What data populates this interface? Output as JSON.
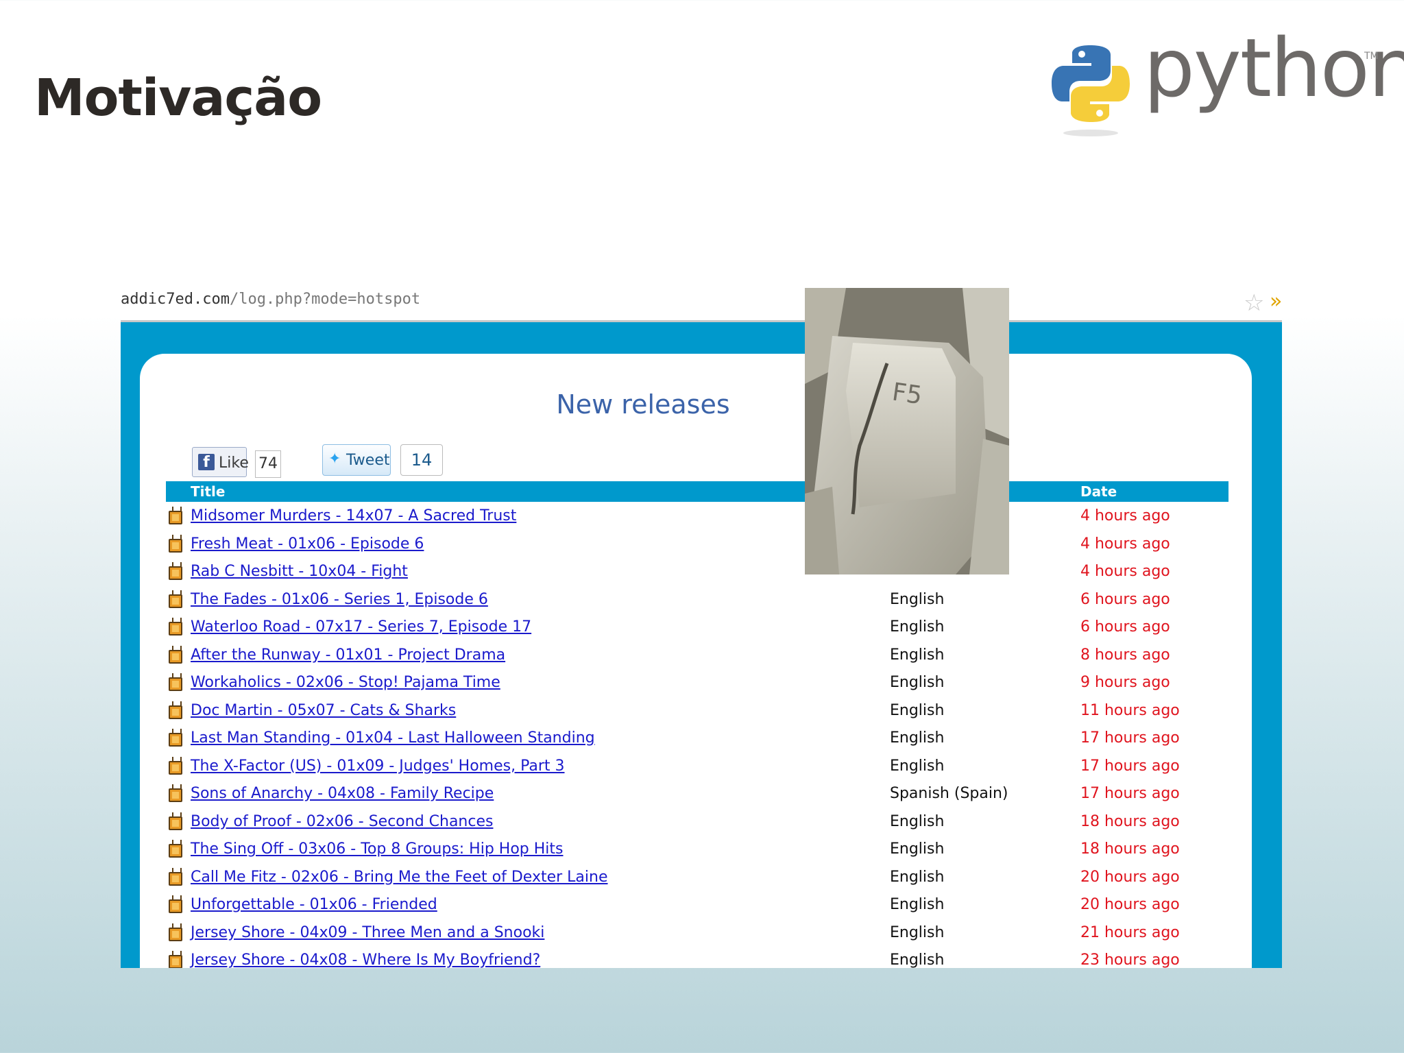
{
  "slide": {
    "title": "Motivação"
  },
  "logo": {
    "text": "python",
    "tm": "TM"
  },
  "browser": {
    "url_host": "addic7ed.com",
    "url_path": "/log.php?mode=hotspot"
  },
  "page": {
    "heading": "New releases",
    "facebook": {
      "label": "Like",
      "count": "74"
    },
    "twitter": {
      "label": "Tweet",
      "count": "14"
    },
    "columns": {
      "title": "Title",
      "date": "Date"
    },
    "key_photo_label": "F5",
    "rows": [
      {
        "title": "Midsomer Murders - 14x07 - A Sacred Trust",
        "lang": "",
        "date": "4 hours ago"
      },
      {
        "title": "Fresh Meat - 01x06 - Episode 6",
        "lang": "",
        "date": "4 hours ago"
      },
      {
        "title": "Rab C Nesbitt - 10x04 - Fight",
        "lang": "",
        "date": "4 hours ago"
      },
      {
        "title": "The Fades - 01x06 - Series 1, Episode 6",
        "lang": "English",
        "date": "6 hours ago"
      },
      {
        "title": "Waterloo Road - 07x17 - Series 7, Episode 17",
        "lang": "English",
        "date": "6 hours ago"
      },
      {
        "title": "After the Runway - 01x01 - Project Drama",
        "lang": "English",
        "date": "8 hours ago"
      },
      {
        "title": "Workaholics - 02x06 - Stop! Pajama Time",
        "lang": "English",
        "date": "9 hours ago"
      },
      {
        "title": "Doc Martin - 05x07 - Cats & Sharks",
        "lang": "English",
        "date": "11 hours ago"
      },
      {
        "title": "Last Man Standing - 01x04 - Last Halloween Standing",
        "lang": "English",
        "date": "17 hours ago"
      },
      {
        "title": "The X-Factor (US) - 01x09 - Judges' Homes, Part 3",
        "lang": "English",
        "date": "17 hours ago"
      },
      {
        "title": "Sons of Anarchy - 04x08 - Family Recipe",
        "lang": "Spanish (Spain)",
        "date": "17 hours ago"
      },
      {
        "title": "Body of Proof - 02x06 - Second Chances",
        "lang": "English",
        "date": "18 hours ago"
      },
      {
        "title": "The Sing Off - 03x06 - Top 8 Groups: Hip Hop Hits",
        "lang": "English",
        "date": "18 hours ago"
      },
      {
        "title": "Call Me Fitz - 02x06 - Bring Me the Feet of Dexter Laine",
        "lang": "English",
        "date": "20 hours ago"
      },
      {
        "title": "Unforgettable - 01x06 - Friended",
        "lang": "English",
        "date": "20 hours ago"
      },
      {
        "title": "Jersey Shore - 04x09 - Three Men and a Snooki",
        "lang": "English",
        "date": "21 hours ago"
      },
      {
        "title": "Jersey Shore - 04x08 - Where Is My Boyfriend?",
        "lang": "English",
        "date": "23 hours ago"
      }
    ]
  },
  "colors": {
    "site_blue": "#0099cc",
    "link_blue": "#1a1acc",
    "date_red": "#e0141e",
    "python_blue": "#3874b4",
    "python_yellow": "#f5cd3a"
  }
}
